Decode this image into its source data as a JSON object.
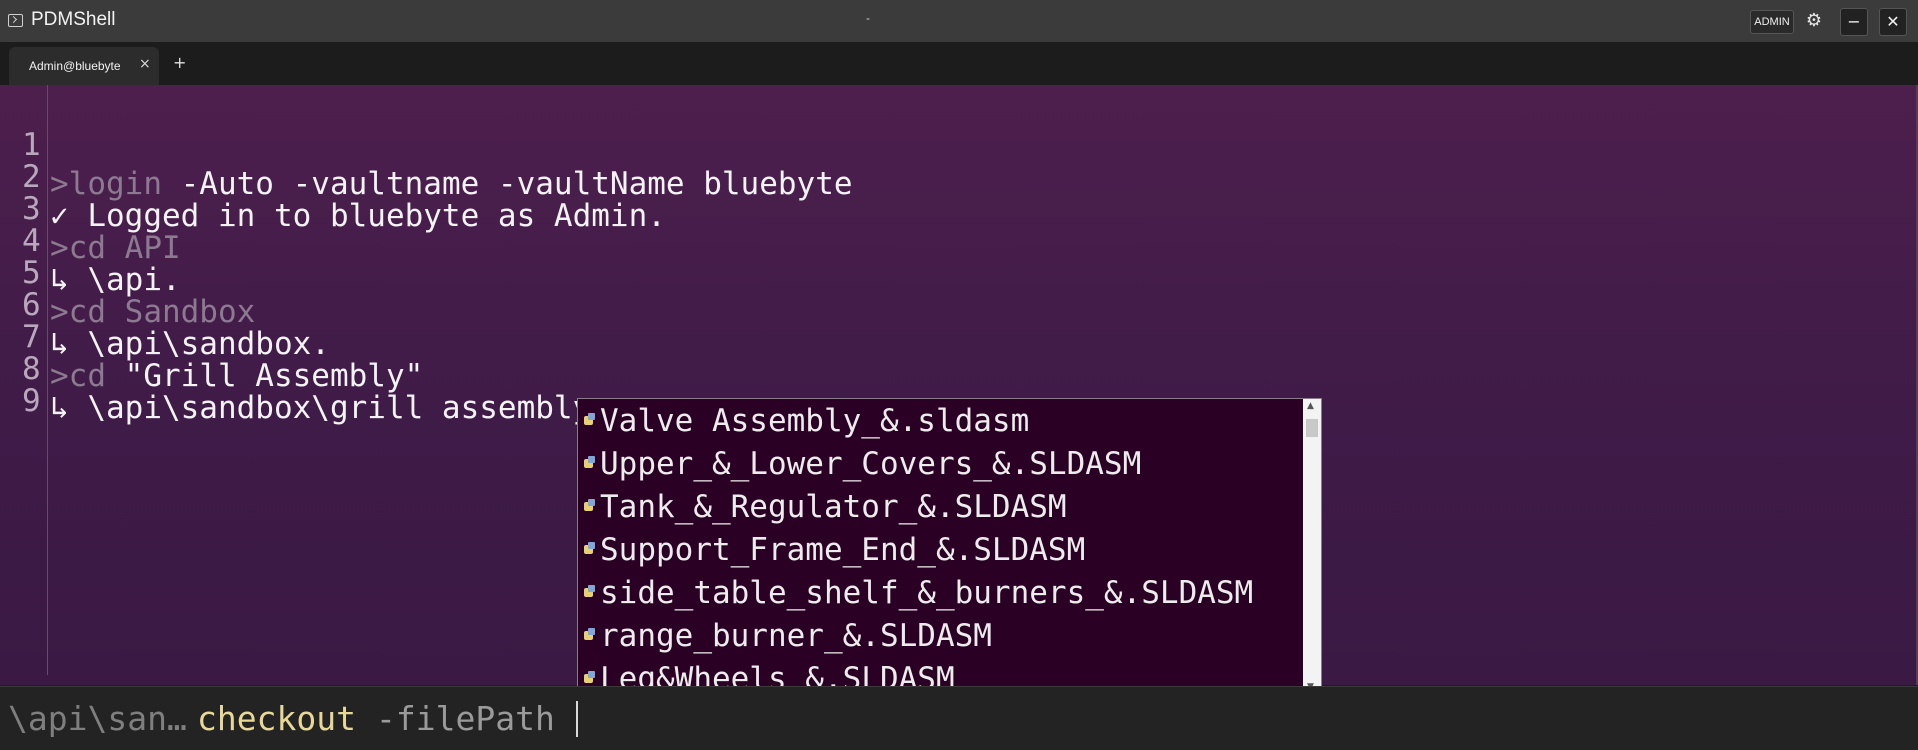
{
  "window": {
    "title": "PDMShell",
    "center_text": "-",
    "admin_badge": "ADMIN",
    "minimize_glyph": "−",
    "close_glyph": "✕"
  },
  "tabs": [
    {
      "label": "Admin@bluebyte",
      "close_glyph": "×"
    }
  ],
  "new_tab_glyph": "+",
  "console": {
    "lines": [
      {
        "num": "1",
        "prompt": ">login",
        "text": " -Auto -vaultname -vaultName bluebyte"
      },
      {
        "num": "2",
        "prompt": "",
        "text": "✓ Logged in to bluebyte as Admin."
      },
      {
        "num": "3",
        "prompt": ">cd API",
        "text": ""
      },
      {
        "num": "4",
        "prompt": "",
        "text": "↳ \\api."
      },
      {
        "num": "5",
        "prompt": ">cd Sandbox",
        "text": ""
      },
      {
        "num": "6",
        "prompt": "",
        "text": "↳ \\api\\sandbox."
      },
      {
        "num": "7",
        "prompt": ">cd",
        "text": " \"Grill Assembly\""
      },
      {
        "num": "8",
        "prompt": "",
        "text": "↳ \\api\\sandbox\\grill assembly."
      },
      {
        "num": "9",
        "prompt": "",
        "text": ""
      }
    ]
  },
  "autocomplete": {
    "items": [
      "Valve Assembly_&.sldasm",
      "Upper_&_Lower_Covers_&.SLDASM",
      "Tank_&_Regulator_&.SLDASM",
      "Support_Frame_End_&.SLDASM",
      "side_table_shelf_&_burners_&.SLDASM",
      "range_burner_&.SLDASM",
      "Leg&Wheels_&.SLDASM"
    ],
    "item_icon": "assembly-file-icon"
  },
  "input": {
    "path": "\\api\\san…",
    "command": "checkout",
    "argument": "-filePath",
    "value": ""
  },
  "colors": {
    "editor_bg": "#4d1f4d",
    "popup_bg": "#2a0124",
    "command_highlight": "#e8d896"
  }
}
